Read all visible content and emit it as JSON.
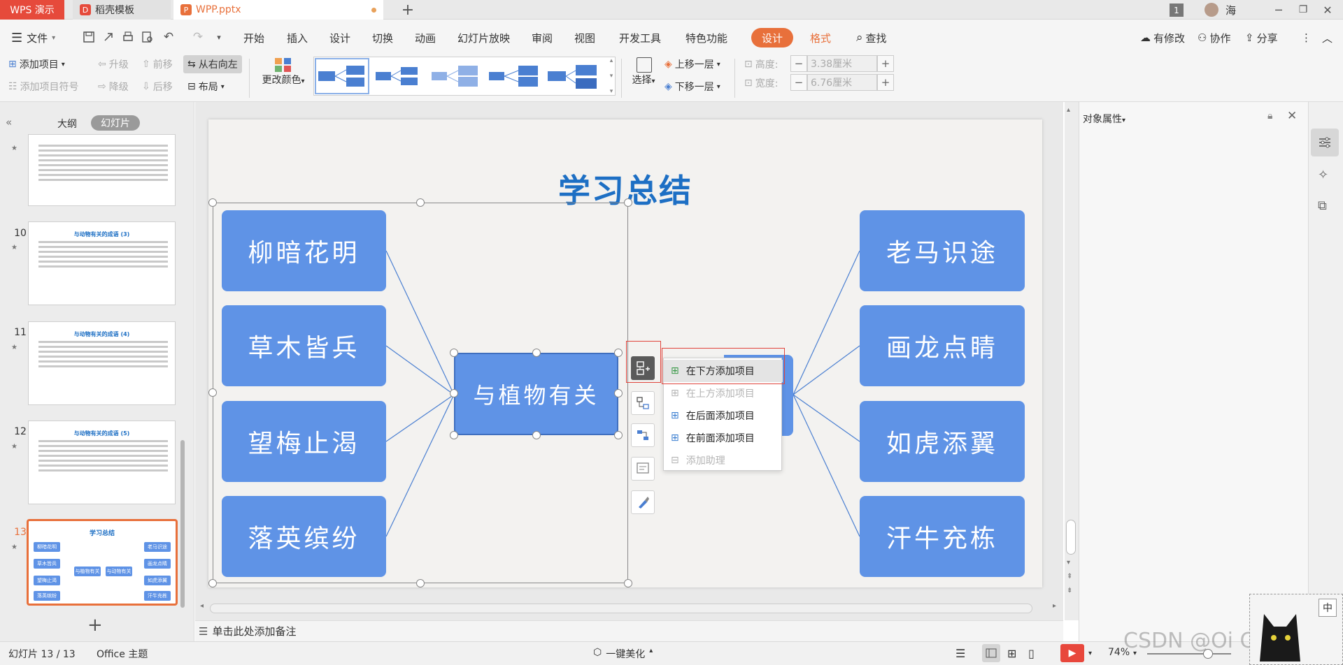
{
  "titlebar": {
    "tabs": [
      {
        "label": "WPS 演示"
      },
      {
        "label": "稻壳模板"
      },
      {
        "label": "WPP.pptx"
      }
    ],
    "page_badge": "1",
    "user_name": "海"
  },
  "menubar": {
    "file_label": "文件",
    "items": [
      "开始",
      "插入",
      "设计",
      "切换",
      "动画",
      "幻灯片放映",
      "审阅",
      "视图",
      "开发工具",
      "特色功能"
    ],
    "design_tab": "设计",
    "format_tab": "格式",
    "search_label": "查找",
    "right": [
      "有修改",
      "协作",
      "分享"
    ]
  },
  "ribbon": {
    "add_item": "添加项目",
    "add_bullet": "添加项目符号",
    "promote": "升级",
    "demote": "降级",
    "move_forward": "前移",
    "move_back": "后移",
    "right_to_left": "从右向左",
    "layout": "布局",
    "change_color": "更改颜色",
    "select": "选择",
    "bring_forward": "上移一层",
    "send_backward": "下移一层",
    "height_label": "高度:",
    "height_value": "3.38厘米",
    "width_label": "宽度:",
    "width_value": "6.76厘米"
  },
  "leftpanel": {
    "tab_outline": "大纲",
    "tab_slides": "幻灯片",
    "thumbs": [
      {
        "num": "",
        "title": ""
      },
      {
        "num": "10",
        "title": "与动物有关的成语 (3)"
      },
      {
        "num": "11",
        "title": "与动物有关的成语 (4)"
      },
      {
        "num": "12",
        "title": "与动物有关的成语 (5)"
      },
      {
        "num": "13",
        "title": "学习总结"
      }
    ],
    "thumb13": {
      "left": [
        "柳暗花明",
        "草木皆兵",
        "望梅止渴",
        "落英缤纷"
      ],
      "right": [
        "老马识途",
        "画龙点睛",
        "如虎添翼",
        "汗牛充栋"
      ],
      "center_left": "与植物有关",
      "center_right": "与动物有关"
    }
  },
  "slide": {
    "title": "学习总结",
    "left_items": [
      "柳暗花明",
      "草木皆兵",
      "望梅止渴",
      "落英缤纷"
    ],
    "right_items": [
      "老马识途",
      "画龙点睛",
      "如虎添翼",
      "汗牛充栋"
    ],
    "center_left": "与植物有关"
  },
  "context_menu": {
    "items": [
      {
        "label": "在下方添加项目",
        "enabled": true,
        "highlighted": true
      },
      {
        "label": "在上方添加项目",
        "enabled": false
      },
      {
        "label": "在后面添加项目",
        "enabled": true
      },
      {
        "label": "在前面添加项目",
        "enabled": true
      },
      {
        "label": "添加助理",
        "enabled": false
      }
    ]
  },
  "rightpanel": {
    "title": "对象属性"
  },
  "notes": {
    "placeholder": "单击此处添加备注"
  },
  "statusbar": {
    "slide_count": "幻灯片 13 / 13",
    "theme": "Office 主题",
    "beautify": "一键美化",
    "zoom": "74%",
    "ime": "中"
  },
  "watermark": "CSDN @Oi Correct",
  "colors": {
    "accent_orange": "#e8703b",
    "box_blue": "#5f93e6",
    "title_blue": "#1d6fc4",
    "wps_red": "#e64a3b"
  }
}
